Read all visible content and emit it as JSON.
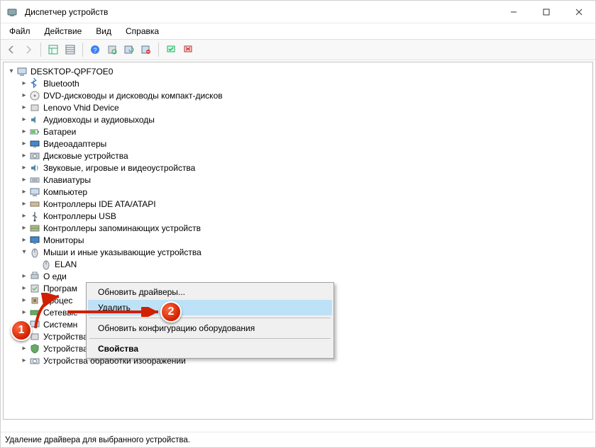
{
  "window": {
    "title": "Диспетчер устройств"
  },
  "menu": {
    "file": "Файл",
    "action": "Действие",
    "view": "Вид",
    "help": "Справка"
  },
  "tree": {
    "root": "DESKTOP-QPF7OE0",
    "cat": {
      "bluetooth": "Bluetooth",
      "dvdcd": "DVD-дисководы и дисководы компакт-дисков",
      "lenovo": "Lenovo Vhid Device",
      "audio": "Аудиовходы и аудиовыходы",
      "batteries": "Батареи",
      "display": "Видеоадаптеры",
      "disk": "Дисковые устройства",
      "multimedia": "Звуковые, игровые и видеоустройства",
      "keyboard": "Клавиатуры",
      "computer": "Компьютер",
      "ide": "Контроллеры IDE ATA/ATAPI",
      "usb": "Контроллеры USB",
      "storage": "Контроллеры запоминающих устройств",
      "monitors": "Мониторы",
      "mice": "Мыши и иные указывающие устройства",
      "elan": "ELAN",
      "printqueue": "О       еди",
      "software": "Програм",
      "cpu": "Процес",
      "network": "Сетевые",
      "system": "Системн",
      "hid": "Устройства HID (Human Interface Devices)",
      "security": "Устройства безопасности",
      "imaging": "Устройства обработки изображений"
    }
  },
  "context_menu": {
    "update": "Обновить драйверы...",
    "remove": "Удалить",
    "rescan": "Обновить конфигурацию оборудования",
    "properties": "Свойства"
  },
  "status": "Удаление драйвера для выбранного устройства.",
  "markers": {
    "one": "1",
    "two": "2"
  }
}
